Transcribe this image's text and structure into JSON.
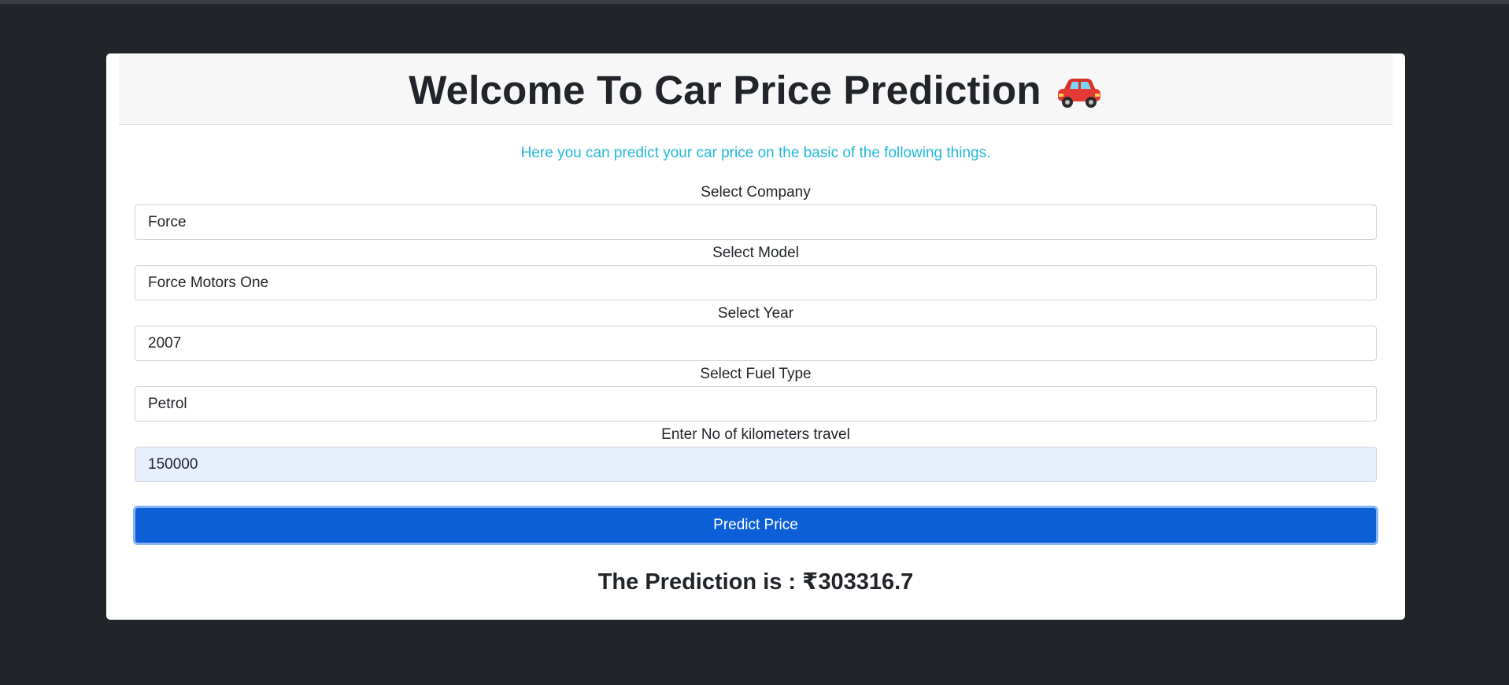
{
  "header": {
    "title": "Welcome To Car Price Prediction",
    "icon": "car-icon"
  },
  "subtitle": "Here you can predict your car price on the basic of the following things.",
  "form": {
    "company": {
      "label": "Select Company",
      "value": "Force"
    },
    "model": {
      "label": "Select Model",
      "value": "Force Motors One"
    },
    "year": {
      "label": "Select Year",
      "value": "2007"
    },
    "fuel": {
      "label": "Select Fuel Type",
      "value": "Petrol"
    },
    "kms": {
      "label": "Enter No of kilometers travel",
      "value": "150000"
    }
  },
  "button": {
    "label": "Predict Price"
  },
  "result": {
    "text": "The Prediction is : ₹303316.7"
  },
  "colors": {
    "background": "#212529",
    "accent": "#0d5fd8",
    "subtitle": "#22b8d8"
  }
}
